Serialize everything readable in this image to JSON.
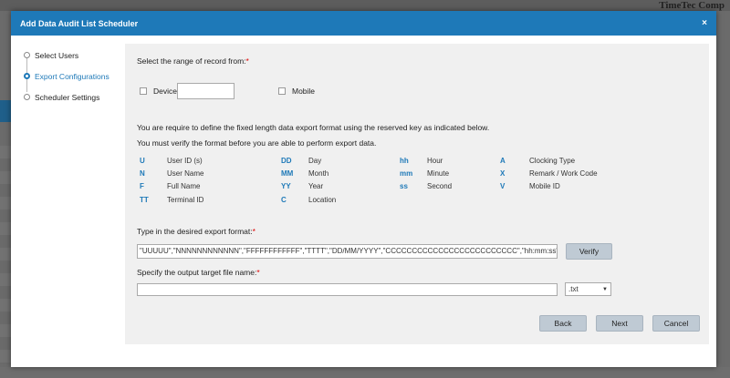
{
  "background": {
    "brand": "TimeTec Comp"
  },
  "dialog": {
    "title": "Add Data Audit List Scheduler",
    "close": "×"
  },
  "steps": [
    {
      "label": "Select Users"
    },
    {
      "label": "Export Configurations"
    },
    {
      "label": "Scheduler Settings"
    }
  ],
  "range": {
    "label": "Select the range of record from:",
    "required": "*",
    "device_label": "Device",
    "device_value": "",
    "mobile_label": "Mobile"
  },
  "instructions": {
    "line1": "You are require to define the fixed length data export format using the reserved key as indicated below.",
    "line2": "You must verify the format before you are able to perform export data."
  },
  "keys": [
    {
      "key": "U",
      "desc": "User ID (s)"
    },
    {
      "key": "N",
      "desc": "User Name"
    },
    {
      "key": "F",
      "desc": "Full Name"
    },
    {
      "key": "TT",
      "desc": "Terminal ID"
    },
    {
      "key": "DD",
      "desc": "Day"
    },
    {
      "key": "MM",
      "desc": "Month"
    },
    {
      "key": "YY",
      "desc": "Year"
    },
    {
      "key": "C",
      "desc": "Location"
    },
    {
      "key": "hh",
      "desc": "Hour"
    },
    {
      "key": "mm",
      "desc": "Minute"
    },
    {
      "key": "ss",
      "desc": "Second"
    },
    {
      "key": "A",
      "desc": "Clocking Type"
    },
    {
      "key": "X",
      "desc": "Remark / Work Code"
    },
    {
      "key": "V",
      "desc": "Mobile ID"
    }
  ],
  "format": {
    "label": "Type in the desired export format:",
    "required": "*",
    "value": "\"UUUUU\",\"NNNNNNNNNNNN\",\"FFFFFFFFFFFF\",\"TTTT\",\"DD/MM/YYYY\",\"CCCCCCCCCCCCCCCCCCCCCCCCC\",\"hh:mm:ss\",\"AAAAAA",
    "verify": "Verify"
  },
  "filename": {
    "label": "Specify the output target file name:",
    "required": "*",
    "value": "",
    "ext": ".txt"
  },
  "buttons": {
    "back": "Back",
    "next": "Next",
    "cancel": "Cancel"
  }
}
